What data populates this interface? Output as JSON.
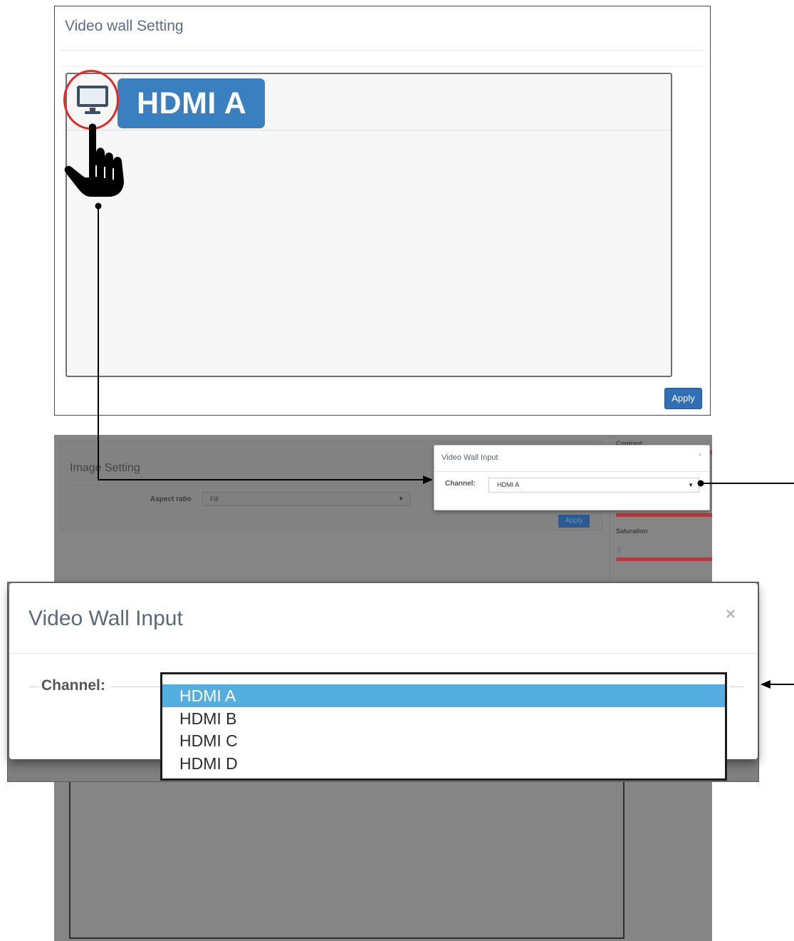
{
  "video_wall_setting": {
    "title": "Video wall Setting",
    "source_badge": "HDMI A",
    "apply_label": "Apply",
    "icons": [
      "monitor-icon",
      "pointing-hand-icon"
    ]
  },
  "image_setting": {
    "title": "Image Setting",
    "aspect_ratio_label": "Aspect ratio",
    "aspect_ratio_value": "Fill",
    "apply_label": "Apply",
    "contrast_label": "Contrast",
    "saturation_label": "Saturation",
    "saturation_value": "0"
  },
  "small_modal": {
    "title": "Video Wall Input",
    "close_glyph": "×",
    "channel_label": "Channel:",
    "channel_value": "HDMI A"
  },
  "big_modal": {
    "title": "Video Wall Input",
    "close_glyph": "×",
    "channel_label": "Channel:",
    "options": [
      "HDMI A",
      "HDMI B",
      "HDMI C",
      "HDMI D"
    ],
    "selected_option": "HDMI A"
  },
  "colors": {
    "badge_blue": "#3a7fbf",
    "highlight_red": "#e12b2b",
    "selected_option": "#55aee0",
    "apply_blue": "#2f6fb8"
  }
}
